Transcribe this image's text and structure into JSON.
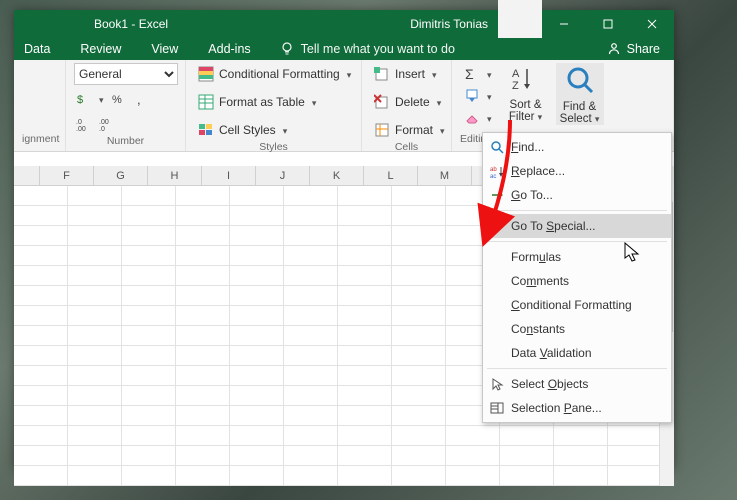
{
  "title": {
    "doc": "Book1  -  Excel",
    "user": "Dimitris Tonias"
  },
  "tabs": [
    "Data",
    "Review",
    "View",
    "Add-ins"
  ],
  "tellme": "Tell me what you want to do",
  "share": "Share",
  "ribbon": {
    "alignment_group": "ignment",
    "number_group": "Number",
    "number_format": "General",
    "styles_group": "Styles",
    "styles": {
      "cf": "Conditional Formatting",
      "fat": "Format as Table",
      "cs": "Cell Styles"
    },
    "cells_group": "Cells",
    "cells": {
      "ins": "Insert",
      "del": "Delete",
      "fmt": "Format"
    },
    "editing_group": "Editing",
    "editing": {
      "sort": "Sort &",
      "filter": "Filter",
      "find": "Find &",
      "select": "Select"
    }
  },
  "columns": [
    "F",
    "G",
    "H",
    "I",
    "J",
    "K",
    "L",
    "M"
  ],
  "menu": {
    "find": "Find...",
    "replace": "Replace...",
    "goto": "Go To...",
    "gotospecial": "Go To Special...",
    "formulas": "Formulas",
    "comments": "Comments",
    "condfmt": "Conditional Formatting",
    "constants": "Constants",
    "datavalid": "Data Validation",
    "selobj": "Select Objects",
    "selpane": "Selection Pane..."
  }
}
